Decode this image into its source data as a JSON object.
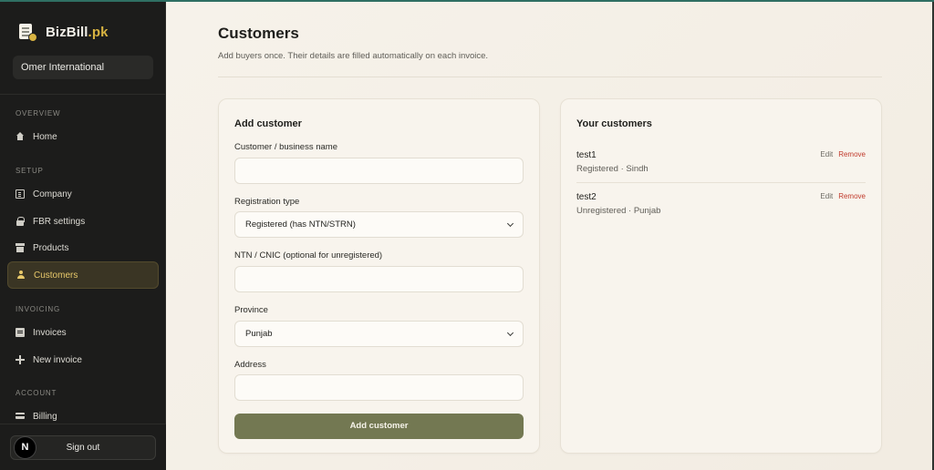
{
  "brand": {
    "name": "BizBill",
    "tld": ".pk"
  },
  "company_selector": {
    "value": "Omer International"
  },
  "sidebar": {
    "sections": [
      {
        "label": "OVERVIEW",
        "items": [
          {
            "label": "Home",
            "icon": "home-icon"
          }
        ]
      },
      {
        "label": "SETUP",
        "items": [
          {
            "label": "Company",
            "icon": "building-icon"
          },
          {
            "label": "FBR settings",
            "icon": "lock-icon"
          },
          {
            "label": "Products",
            "icon": "box-icon"
          },
          {
            "label": "Customers",
            "icon": "user-icon",
            "active": true
          }
        ]
      },
      {
        "label": "INVOICING",
        "items": [
          {
            "label": "Invoices",
            "icon": "invoice-icon"
          },
          {
            "label": "New invoice",
            "icon": "plus-icon"
          }
        ]
      },
      {
        "label": "ACCOUNT",
        "items": [
          {
            "label": "Billing",
            "icon": "card-icon"
          }
        ]
      }
    ],
    "signout_label": "Sign out",
    "avatar_letter": "N"
  },
  "page": {
    "title": "Customers",
    "subtitle": "Add buyers once. Their details are filled automatically on each invoice."
  },
  "add_form": {
    "title": "Add customer",
    "name_label": "Customer / business name",
    "name_value": "",
    "reg_type_label": "Registration type",
    "reg_type_value": "Registered (has NTN/STRN)",
    "ntn_label": "NTN / CNIC (optional for unregistered)",
    "ntn_value": "",
    "province_label": "Province",
    "province_value": "Punjab",
    "address_label": "Address",
    "address_value": "",
    "submit_label": "Add customer"
  },
  "customers": {
    "title": "Your customers",
    "edit_label": "Edit",
    "remove_label": "Remove",
    "items": [
      {
        "name": "test1",
        "meta": "Registered · Sindh"
      },
      {
        "name": "test2",
        "meta": "Unregistered · Punjab"
      }
    ]
  },
  "colors": {
    "accent": "#737852",
    "active_nav": "#e8c96a",
    "remove": "#c0392b",
    "sidebar_bg": "#1c1c1b"
  }
}
